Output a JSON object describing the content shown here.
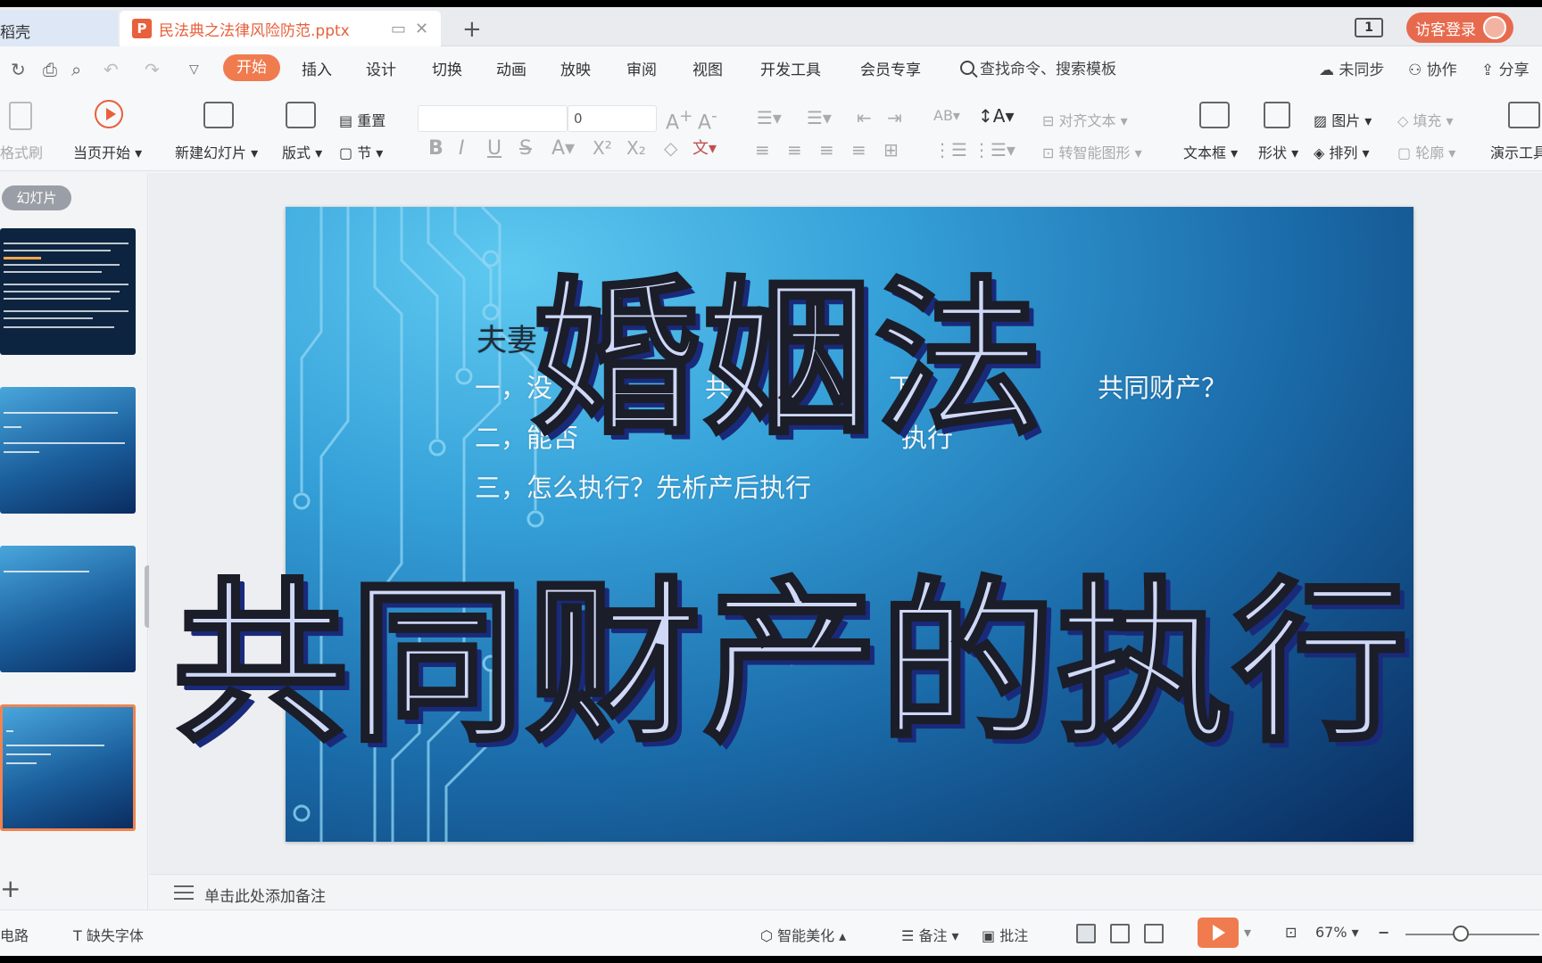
{
  "tabs": {
    "home": "稻壳",
    "doc_title": "民法典之法律风险防范.pptx",
    "doc_badge": "P",
    "window_count": "1",
    "login": "访客登录"
  },
  "menu": {
    "items": [
      "开始",
      "插入",
      "设计",
      "切换",
      "动画",
      "放映",
      "审阅",
      "视图",
      "开发工具",
      "会员专享"
    ],
    "active": "开始",
    "search": "查找命令、搜索模板",
    "sync": "未同步",
    "collab": "协作",
    "share": "分享"
  },
  "ribbon": {
    "format_painter": "格式刷",
    "play_from_current": "当页开始",
    "new_slide": "新建幻灯片",
    "layout": "版式",
    "reset": "重置",
    "section": "节",
    "font_size": "0",
    "align_text": "对齐文本",
    "smart_art": "转智能图形",
    "textbox": "文本框",
    "shape": "形状",
    "picture": "图片",
    "fill": "填充",
    "arrange": "排列",
    "outline": "轮廓",
    "present_tools": "演示工具"
  },
  "panel": {
    "label": "幻灯片",
    "add": "+"
  },
  "slide": {
    "heading": "夫妻",
    "line1a": "一，没",
    "line1b": "共",
    "line1c": "下",
    "line1d": "共同财产？",
    "line2a": "二，能否",
    "line2b": "执行",
    "line3": "三，怎么执行？先析产后执行"
  },
  "overlay": {
    "title1": "婚姻法",
    "title2": "共同财产的执行"
  },
  "notes": {
    "placeholder": "单击此处添加备注"
  },
  "status": {
    "spell": "电路",
    "missing_font": "缺失字体",
    "smart_beautify": "智能美化",
    "notes": "备注",
    "comments": "批注",
    "zoom": "67%"
  },
  "colors": {
    "accent": "#f07b4f",
    "tab_title": "#e8603c",
    "overlay_fill": "#cfd8f6",
    "overlay_shadow": "#1a2a7a"
  }
}
